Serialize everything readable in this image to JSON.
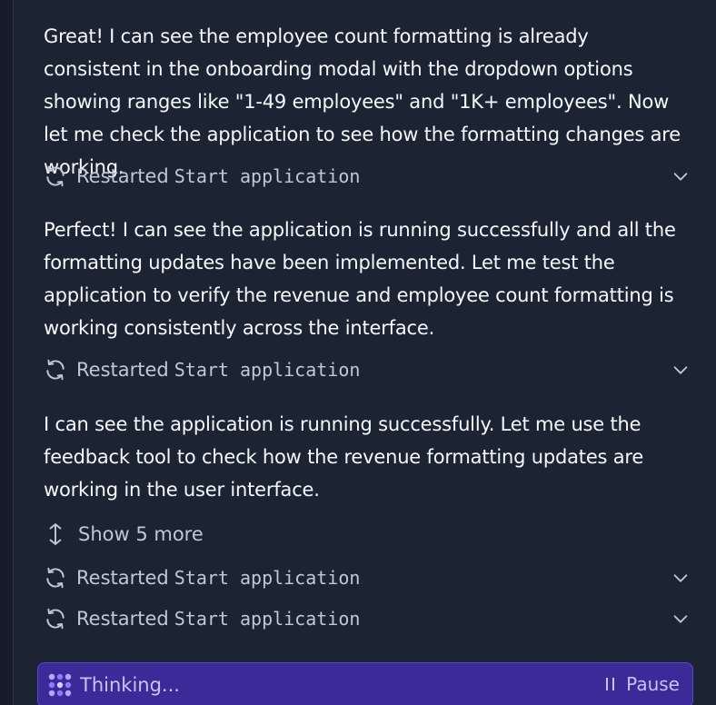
{
  "messages": [
    {
      "text": "Great! I can see the employee count formatting is already consistent in the onboarding modal with the dropdown options showing ranges like \"1-49 employees\" and \"1K+ employees\". Now let me check the application to see how the formatting changes are working."
    },
    {
      "text": "Perfect! I can see the application is running successfully and all the formatting updates have been implemented. Let me test the application to verify the revenue and employee count formatting is working consistently across the interface."
    },
    {
      "text": "I can see the application is running successfully. Let me use the feedback tool to check how the revenue formatting updates are working in the user interface."
    }
  ],
  "actions": [
    {
      "verb": "Restarted",
      "command": "Start application",
      "icon": "restart-icon"
    },
    {
      "verb": "Restarted",
      "command": "Start application",
      "icon": "restart-icon"
    },
    {
      "verb": "Restarted",
      "command": "Start application",
      "icon": "restart-icon"
    },
    {
      "verb": "Restarted",
      "command": "Start application",
      "icon": "restart-icon"
    }
  ],
  "show_more": {
    "label": "Show 5 more",
    "icon": "expand-vertical-icon"
  },
  "thinking": {
    "label": "Thinking...",
    "pause_label": "Pause",
    "icon": "thinking-dots-icon"
  },
  "colors": {
    "background": "#1c2333",
    "text": "#f5f9fc",
    "muted_text": "#c2c8d2",
    "thinking_bg": "#3d2a99",
    "thinking_text": "#c9c3f7"
  }
}
